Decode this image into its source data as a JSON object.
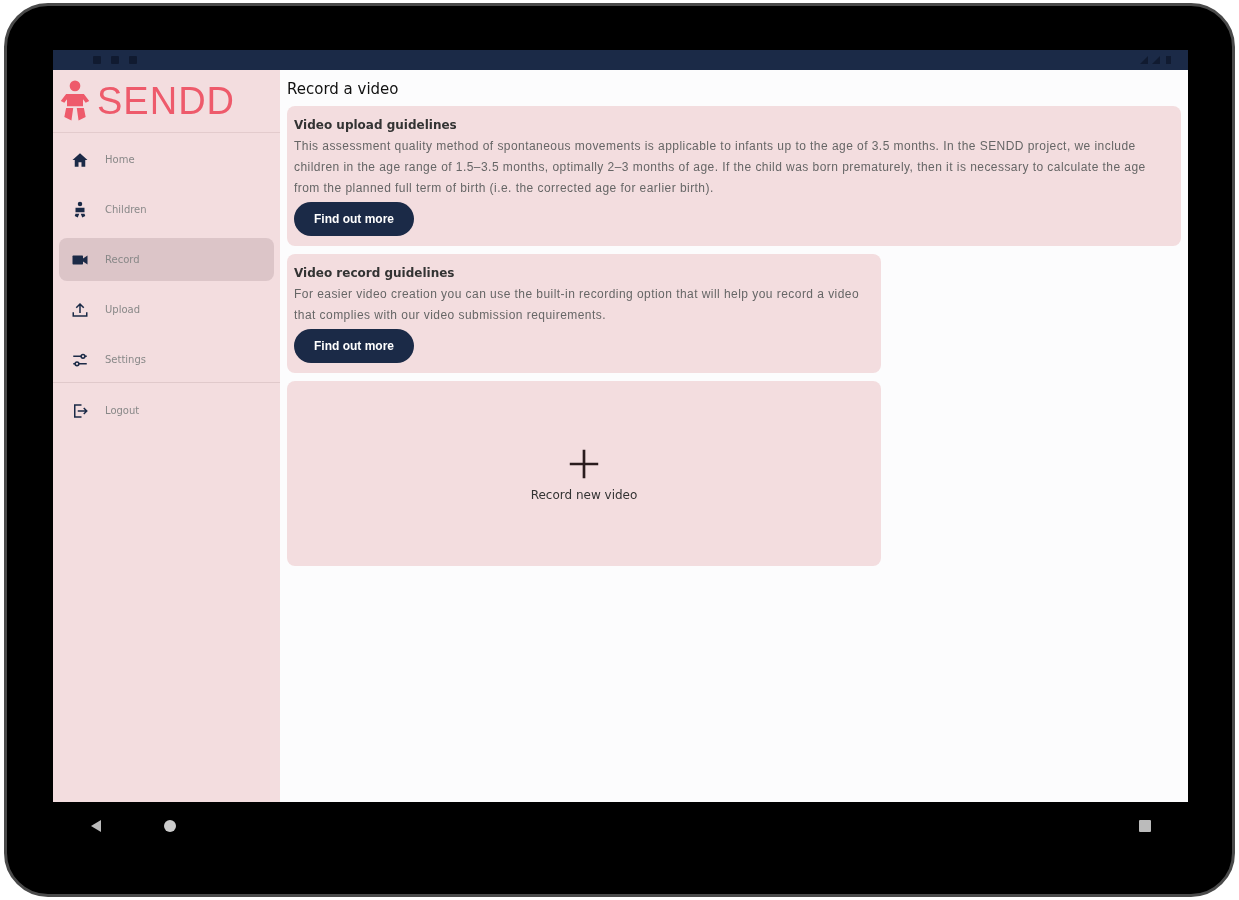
{
  "app": {
    "logo_text": "SENDD"
  },
  "sidebar": {
    "items": [
      {
        "label": "Home",
        "kind": "home",
        "selected": false
      },
      {
        "label": "Children",
        "kind": "child",
        "selected": false
      },
      {
        "label": "Record",
        "kind": "video",
        "selected": true
      },
      {
        "label": "Upload",
        "kind": "upload",
        "selected": false
      },
      {
        "label": "Settings",
        "kind": "settings",
        "selected": false
      },
      {
        "label": "Logout",
        "kind": "logout",
        "selected": false
      }
    ]
  },
  "page": {
    "title": "Record a video"
  },
  "cards": [
    {
      "kind": "info",
      "title": "Video upload guidelines",
      "text": "This assessment quality method of spontaneous movements is applicable to infants up to the age of 3.5 months. In the SENDD project, we include children in the age range of 1.5–3.5 months, optimally 2–3 months of age. If the child was born prematurely, then it is necessary to calculate the age from the planned full term of birth (i.e. the corrected age for earlier birth).",
      "button": "Find out more",
      "wide": true
    },
    {
      "kind": "info",
      "title": "Video record guidelines",
      "text": "For easier video creation you can use the built-in recording option that will help you record a video that complies with our video submission requirements.",
      "button": "Find out more",
      "wide": false
    },
    {
      "kind": "action",
      "label": "Record new video",
      "wide": false
    }
  ]
}
